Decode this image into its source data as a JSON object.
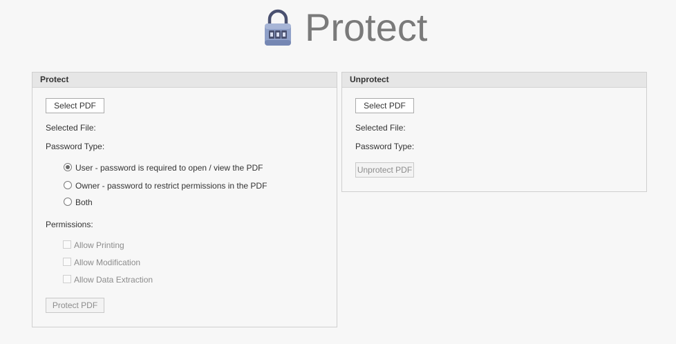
{
  "header": {
    "title": "Protect",
    "icon": "lock-icon"
  },
  "protect": {
    "heading": "Protect",
    "select_button": "Select PDF",
    "selected_file_label": "Selected File:",
    "password_type_label": "Password Type:",
    "password_options": [
      {
        "label": "User - password is required to open / view the PDF",
        "checked": true
      },
      {
        "label": "Owner - password to restrict permissions in the PDF",
        "checked": false
      },
      {
        "label": "Both",
        "checked": false
      }
    ],
    "permissions_label": "Permissions:",
    "permissions": [
      {
        "label": "Allow Printing",
        "checked": false,
        "enabled": false
      },
      {
        "label": "Allow Modification",
        "checked": false,
        "enabled": false
      },
      {
        "label": "Allow Data Extraction",
        "checked": false,
        "enabled": false
      }
    ],
    "action_button": "Protect PDF"
  },
  "unprotect": {
    "heading": "Unprotect",
    "select_button": "Select PDF",
    "selected_file_label": "Selected File:",
    "password_type_label": "Password Type:",
    "action_button": "Unprotect PDF"
  },
  "colors": {
    "background": "#f7f7f7",
    "panel_header": "#e6e6e6",
    "title_text": "#7a7a7a",
    "lock_body": "#8fa0c8",
    "lock_shackle": "#4a5170"
  }
}
